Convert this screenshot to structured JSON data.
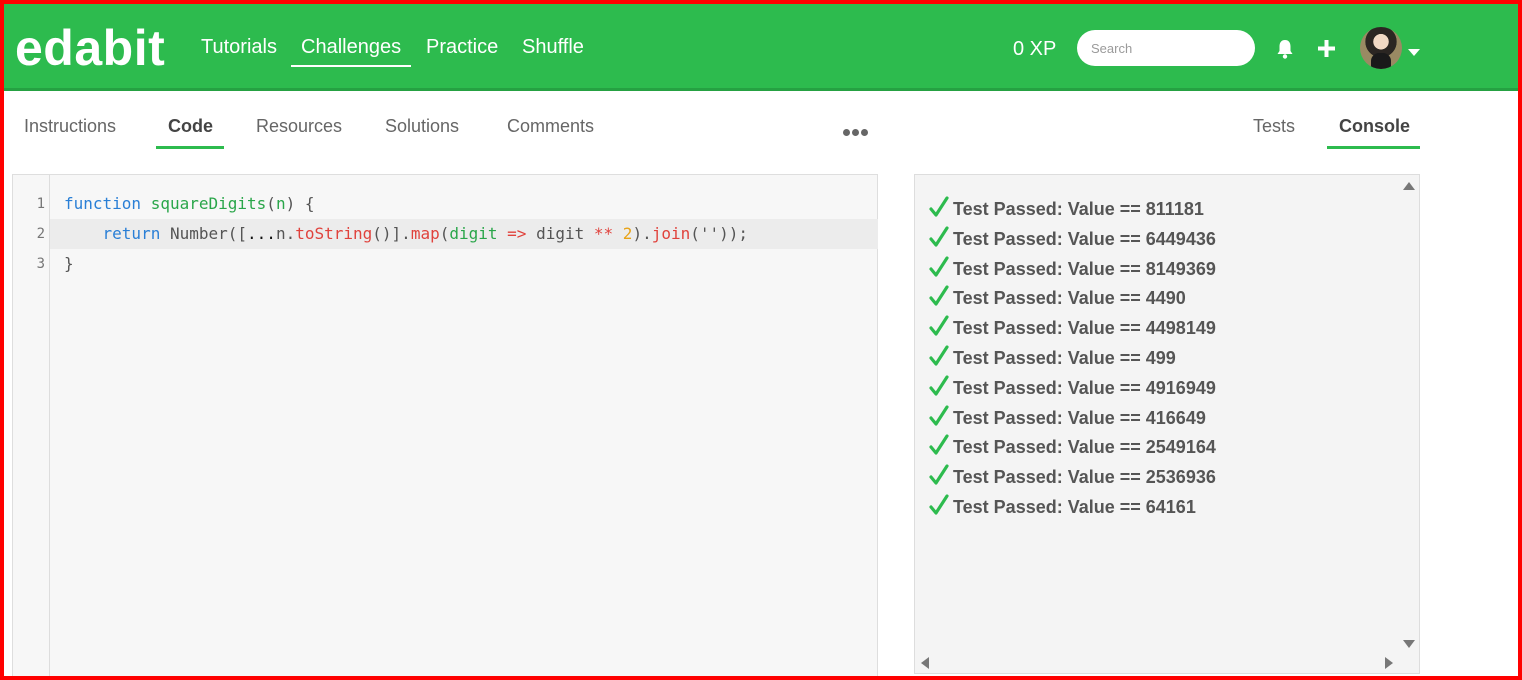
{
  "app": {
    "logo": "edabit"
  },
  "nav": {
    "links": [
      "Tutorials",
      "Challenges",
      "Practice",
      "Shuffle"
    ],
    "active": "Challenges"
  },
  "header": {
    "xp": "0 XP",
    "search_placeholder": "Search",
    "icons": [
      "bell-icon",
      "plus-icon",
      "avatar",
      "chevron-down-icon"
    ]
  },
  "left_tabs": [
    "Instructions",
    "Code",
    "Resources",
    "Solutions",
    "Comments"
  ],
  "left_active_tab": "Code",
  "right_tabs": [
    "Tests",
    "Console"
  ],
  "right_active_tab": "Console",
  "editor": {
    "line_numbers": [
      "1",
      "2",
      "3"
    ],
    "lines": [
      "function squareDigits(n) {",
      "    return Number([...n.toString()].map(digit => digit ** 2).join(''));",
      "}"
    ],
    "active_line": 2
  },
  "console": {
    "results": [
      "Test Passed: Value == 811181",
      "Test Passed: Value == 6449436",
      "Test Passed: Value == 8149369",
      "Test Passed: Value == 4490",
      "Test Passed: Value == 4498149",
      "Test Passed: Value == 499",
      "Test Passed: Value == 4916949",
      "Test Passed: Value == 416649",
      "Test Passed: Value == 2549164",
      "Test Passed: Value == 2536936",
      "Test Passed: Value == 64161"
    ]
  },
  "colors": {
    "brand_green": "#2dbb4e",
    "pass_green": "#2dbb4e",
    "keyword": "#2a7fd6",
    "function_name": "#2aa64a",
    "method": "#e0423c",
    "number": "#e8a317"
  }
}
